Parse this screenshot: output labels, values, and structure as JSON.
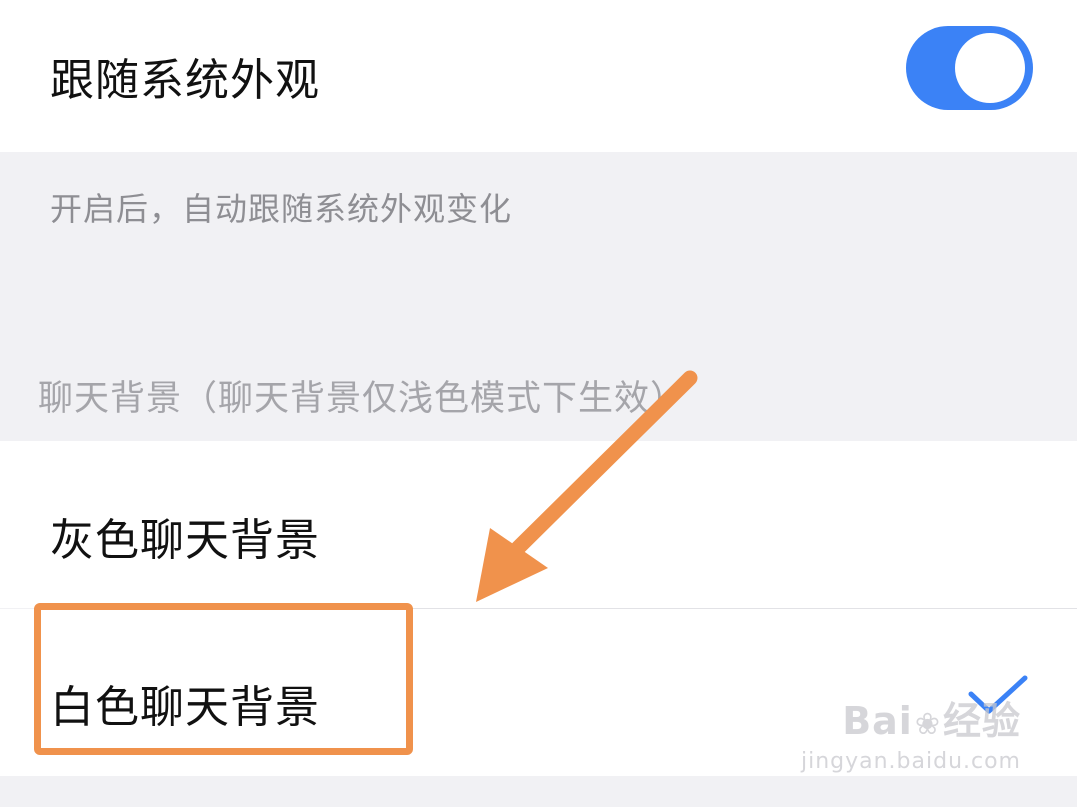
{
  "settings": {
    "follow_system": {
      "label": "跟随系统外观",
      "enabled": true,
      "hint": "开启后，自动跟随系统外观变化"
    },
    "chat_background": {
      "section_label": "聊天背景（聊天背景仅浅色模式下生效）",
      "options": [
        {
          "label": "灰色聊天背景",
          "selected": false
        },
        {
          "label": "白色聊天背景",
          "selected": true
        }
      ]
    }
  },
  "colors": {
    "toggle_on": "#3b82f6",
    "checkmark": "#3b82f6",
    "annotation": "#f0924c",
    "grouped_background": "#f1f1f4"
  },
  "icons": {
    "selected": "checkmark-icon",
    "annotation_pointer": "arrow-icon",
    "watermark_logo": "paw-icon"
  },
  "watermark": {
    "brand_left": "Bai",
    "brand_right": "经验",
    "url": "jingyan.baidu.com"
  }
}
